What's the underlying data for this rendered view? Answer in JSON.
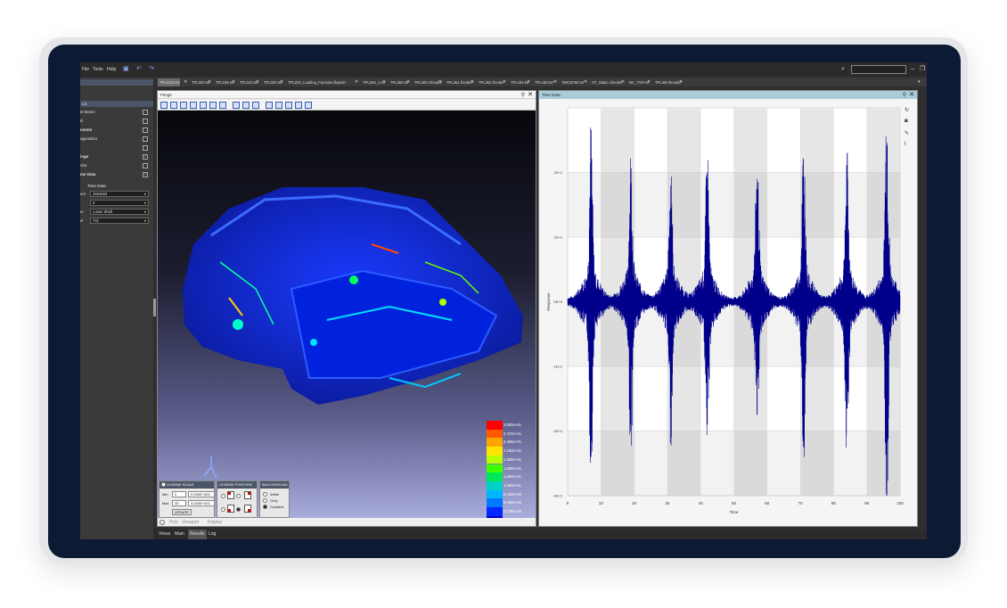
{
  "menu": {
    "items": [
      "File",
      "Tools",
      "Help"
    ],
    "dropdown_glyph": "▾"
  },
  "tabs": [
    "TPL3102.txt",
    "TPL302.txt",
    "TPL195.txt",
    "TPL310.txt",
    "TPL330.txt",
    "TPL220_Loading_Function.fbxadx*",
    "TPL263_1.txt",
    "TPL300.txt",
    "TPL300.cfmodel",
    "TPL351.fmodel*",
    "TPL352.fmodel",
    "TPL194.txt",
    "TPL180.txt*",
    "TMCDF50.txt",
    "CF_Static.cfmodel",
    "NC_TOP.txt",
    "TPL350.fmodel*"
  ],
  "sidebar": {
    "section_label": "LS",
    "rows": [
      {
        "label": "D Mains",
        "checked": false
      },
      {
        "label": "D",
        "checked": false
      },
      {
        "label": "ments",
        "checked": false
      },
      {
        "label": "agnostics",
        "checked": false
      },
      {
        "label": "",
        "checked": false
      },
      {
        "label": "inge",
        "checked": true
      },
      {
        "label": "ctor",
        "checked": false
      },
      {
        "label": "me Data",
        "checked": true
      }
    ],
    "subheader": "Time Data",
    "fields": [
      {
        "label": "ent",
        "value": "2553683"
      },
      {
        "label": "",
        "value": "0"
      },
      {
        "label": "er",
        "value": "Lower Shell"
      },
      {
        "label": "el",
        "value": "701"
      }
    ]
  },
  "fringe": {
    "title": "Fringe",
    "legend": [
      {
        "label": "3.000e+01",
        "color": "#ff0000"
      },
      {
        "label": "2.727e+01",
        "color": "#ff5a00"
      },
      {
        "label": "2.455e+01",
        "color": "#ffa500"
      },
      {
        "label": "2.182e+01",
        "color": "#ffe600"
      },
      {
        "label": "1.909e+01",
        "color": "#b4ff00"
      },
      {
        "label": "1.636e+01",
        "color": "#3cff00"
      },
      {
        "label": "1.364e+01",
        "color": "#00e65a"
      },
      {
        "label": "1.091e+01",
        "color": "#00d2c8"
      },
      {
        "label": "8.182e+00",
        "color": "#00b4ff"
      },
      {
        "label": "5.455e+00",
        "color": "#0078ff"
      },
      {
        "label": "2.728e+00",
        "color": "#0028ff"
      },
      {
        "label": "1.997e-16",
        "color": "#0000d2"
      }
    ],
    "legend_scale": {
      "title": "LEGEND SCALE",
      "min_label": "Min",
      "min_value": "0",
      "min_scaled": "0.000E+000",
      "max_label": "Max",
      "max_value": "30",
      "max_scaled": "3.000E+001",
      "update_label": "UPDATE"
    },
    "legend_position": {
      "title": "LEGEND POSITION"
    },
    "background": {
      "title": "BACKGROUND",
      "options": [
        "White",
        "Grey",
        "Gradient"
      ],
      "selected": "Gradient"
    },
    "bottom_tabs": [
      "Pick",
      "Viewport",
      "Display"
    ]
  },
  "timedata": {
    "title": "Time Data"
  },
  "chart_data": {
    "type": "line",
    "title": "",
    "xlabel": "Time",
    "ylabel": "Response",
    "xlim": [
      0,
      100
    ],
    "ylim": [
      -3,
      3
    ],
    "xticks": [
      0,
      10,
      20,
      30,
      40,
      50,
      60,
      70,
      80,
      90,
      100
    ],
    "ytick_values": [
      2,
      1,
      0,
      -1,
      -2,
      -3
    ],
    "ytick_labels": [
      "2E+2",
      "1E+2",
      "0E+0",
      "-1E+2",
      "-2E+2",
      "-3E+2"
    ],
    "shaded_bands": [
      [
        10,
        20
      ],
      [
        30,
        40
      ],
      [
        50,
        60
      ],
      [
        70,
        80
      ],
      [
        90,
        100
      ]
    ],
    "grid": true,
    "series": [
      {
        "color": "#00008b",
        "peaks": [
          {
            "x": 7.0,
            "ymax": 2.05,
            "ymin": -2.4
          },
          {
            "x": 19.0,
            "ymax": 1.9,
            "ymin": -2.0
          },
          {
            "x": 31.0,
            "ymax": 1.8,
            "ymin": -1.65
          },
          {
            "x": 42.0,
            "ymax": 2.0,
            "ymin": -1.9
          },
          {
            "x": 57.0,
            "ymax": 1.9,
            "ymin": -1.75
          },
          {
            "x": 71.0,
            "ymax": 1.95,
            "ymin": -2.25
          },
          {
            "x": 84.0,
            "ymax": 1.95,
            "ymin": -1.65
          },
          {
            "x": 96.0,
            "ymax": 2.4,
            "ymin": -3.0
          }
        ]
      }
    ]
  },
  "bottom_tabs": [
    "Views",
    "Main",
    "Results",
    "Log"
  ]
}
